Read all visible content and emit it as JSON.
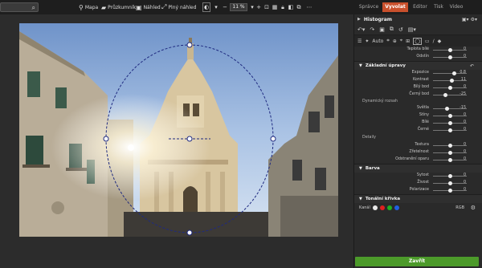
{
  "toolbar": {
    "search_placeholder": "",
    "mapa": "Mapa",
    "pruzkumnik": "Průzkumník",
    "nahled": "Náhled",
    "plny_nahled": "Plný náhled",
    "zoom": "11 %"
  },
  "tabs": [
    "Správce",
    "Vyvolat",
    "Editor",
    "Tisk",
    "Video"
  ],
  "panel": {
    "histogram_title": "Histogram",
    "tool_auto": "Auto",
    "top_rows": [
      {
        "label": "Teplota bílé",
        "value": "0",
        "pos": 0.5
      },
      {
        "label": "Odstín",
        "value": "0",
        "pos": 0.5
      }
    ],
    "zakladni": {
      "title": "Základní úpravy",
      "rows1": [
        {
          "label": "Expozice",
          "value": "0.8",
          "pos": 0.62
        },
        {
          "label": "Kontrast",
          "value": "11",
          "pos": 0.56
        },
        {
          "label": "Bílý bod",
          "value": "0",
          "pos": 0.5
        },
        {
          "label": "Černý bod",
          "value": "-25",
          "pos": 0.38
        }
      ],
      "dynamicky_label": "Dynamický rozsah",
      "rows2": [
        {
          "label": "Světla",
          "value": "-15",
          "pos": 0.42
        },
        {
          "label": "Stíny",
          "value": "0",
          "pos": 0.5
        },
        {
          "label": "Bílé",
          "value": "0",
          "pos": 0.5
        },
        {
          "label": "Černé",
          "value": "0",
          "pos": 0.5
        }
      ],
      "detaily_label": "Detaily",
      "rows3": [
        {
          "label": "Textura",
          "value": "0",
          "pos": 0.5
        },
        {
          "label": "Zřetelnost",
          "value": "0",
          "pos": 0.5
        },
        {
          "label": "Odstranění oparu",
          "value": "0",
          "pos": 0.5
        }
      ]
    },
    "barva": {
      "title": "Barva",
      "rows": [
        {
          "label": "Sytost",
          "value": "0",
          "pos": 0.5
        },
        {
          "label": "Živost",
          "value": "0",
          "pos": 0.5
        },
        {
          "label": "Polarizace",
          "value": "0",
          "pos": 0.5
        }
      ]
    },
    "tonalni": {
      "title": "Tonální křivka",
      "kanal_label": "Kanál",
      "rgb_label": "RGB"
    },
    "close_label": "Zavřít"
  },
  "colors": {
    "active_tab": "#c9502c",
    "close_button": "#4c9a2a",
    "dot_white": "#e8e8e8",
    "dot_red": "#e02020",
    "dot_green": "#20b020",
    "dot_blue": "#2060e0"
  }
}
